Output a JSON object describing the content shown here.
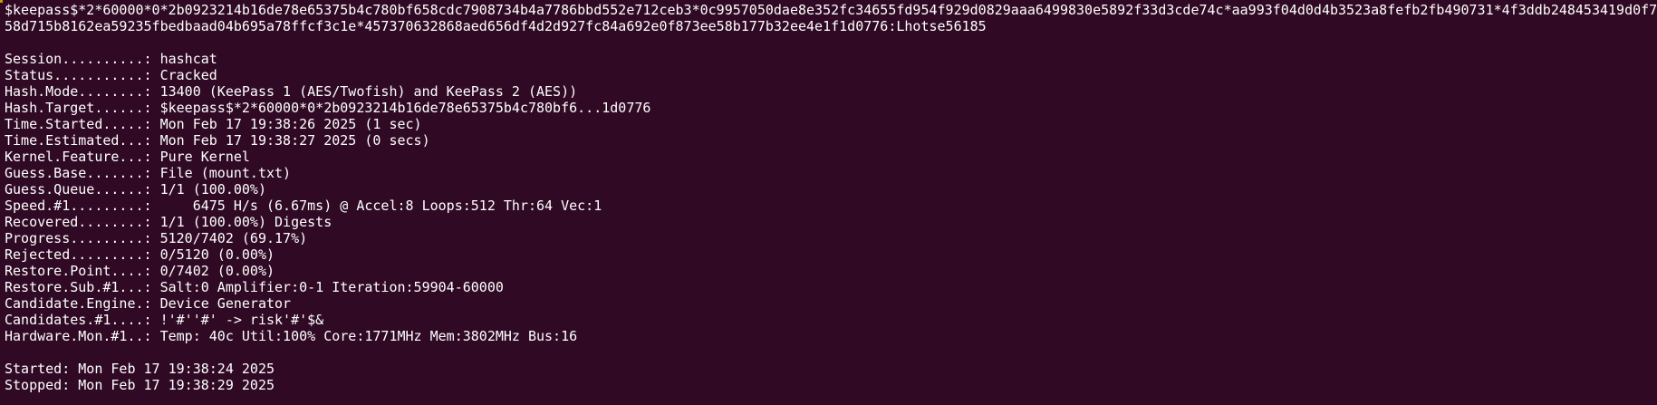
{
  "terminal": {
    "hash_line_1": "$keepass$*2*60000*0*2b0923214b16de78e65375b4c780bf658cdc7908734b4a7786bbd552e712ceb3*0c9957050dae8e352fc34655fd954f929d0829aaa6499830e5892f33d3cde74c*aa993f04d0d4b3523a8fefb2fb490731*4f3ddb248453419d0f79",
    "hash_line_2": "58d715b8162ea59235fbedbaad04b695a78ffcf3c1e*457370632868aed656df4d2d927fc84a692e0f873ee58b177b32ee4e1f1d0776:Lhotse56185",
    "status_lines": [
      "Session..........: hashcat",
      "Status...........: Cracked",
      "Hash.Mode........: 13400 (KeePass 1 (AES/Twofish) and KeePass 2 (AES))",
      "Hash.Target......: $keepass$*2*60000*0*2b0923214b16de78e65375b4c780bf6...1d0776",
      "Time.Started.....: Mon Feb 17 19:38:26 2025 (1 sec)",
      "Time.Estimated...: Mon Feb 17 19:38:27 2025 (0 secs)",
      "Kernel.Feature...: Pure Kernel",
      "Guess.Base.......: File (mount.txt)",
      "Guess.Queue......: 1/1 (100.00%)",
      "Speed.#1.........:     6475 H/s (6.67ms) @ Accel:8 Loops:512 Thr:64 Vec:1",
      "Recovered........: 1/1 (100.00%) Digests",
      "Progress.........: 5120/7402 (69.17%)",
      "Rejected.........: 0/5120 (0.00%)",
      "Restore.Point....: 0/7402 (0.00%)",
      "Restore.Sub.#1...: Salt:0 Amplifier:0-1 Iteration:59904-60000",
      "Candidate.Engine.: Device Generator",
      "Candidates.#1....: !'#''#' -> risk'#'$&",
      "Hardware.Mon.#1..: Temp: 40c Util:100% Core:1771MHz Mem:3802MHz Bus:16"
    ],
    "started_line": "Started: Mon Feb 17 19:38:24 2025",
    "stopped_line": "Stopped: Mon Feb 17 19:38:29 2025"
  }
}
